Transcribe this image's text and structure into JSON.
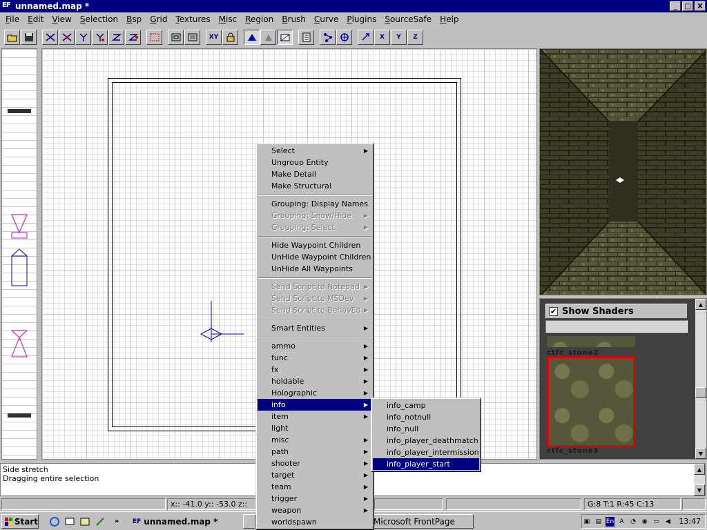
{
  "window": {
    "title": "unnamed.map *",
    "app_icon": "EF",
    "btn_min": "_",
    "btn_max": "□",
    "btn_close": "X"
  },
  "menubar": [
    "File",
    "Edit",
    "View",
    "Selection",
    "Bsp",
    "Grid",
    "Textures",
    "Misc",
    "Region",
    "Brush",
    "Curve",
    "Plugins",
    "SourceSafe",
    "Help"
  ],
  "toolbar": {
    "icons": [
      "open-icon",
      "save-icon",
      "flip-x-icon",
      "rotate-x-icon",
      "flip-y-icon",
      "rotate-y-icon",
      "flip-z-icon",
      "rotate-z-icon",
      "select-complete-tall-icon",
      "select-touching-icon",
      "select-partial-tall-icon",
      "select-inside-icon",
      "change-view-icon",
      "texture-lock-icon",
      "clipper-icon",
      "show-entities-icon",
      "cubic-clip-icon",
      "brush-list-icon",
      "entity-tree-icon",
      "camera-move-icon",
      "scale-icon",
      "scale-x-icon",
      "scale-y-icon",
      "scale-z-icon"
    ],
    "labels": {
      "change_view": "XY",
      "scale_x": "X",
      "scale_y": "Y",
      "scale_z": "Z"
    }
  },
  "context_menu": {
    "items": [
      {
        "label": "Select",
        "submenu": true,
        "disabled": false
      },
      {
        "label": "Ungroup Entity",
        "submenu": false,
        "disabled": false
      },
      {
        "label": "Make Detail",
        "submenu": false,
        "disabled": false
      },
      {
        "label": "Make Structural",
        "submenu": false,
        "disabled": false
      },
      {
        "sep": true
      },
      {
        "label": "Grouping: Display Names",
        "submenu": false,
        "disabled": false
      },
      {
        "label": "Grouping: Show/Hide",
        "submenu": true,
        "disabled": true
      },
      {
        "label": "Grouping: Select",
        "submenu": true,
        "disabled": true
      },
      {
        "sep": true
      },
      {
        "label": "Hide Waypoint Children",
        "submenu": false,
        "disabled": false
      },
      {
        "label": "UnHide Waypoint Children",
        "submenu": false,
        "disabled": false
      },
      {
        "label": "UnHide All Waypoints",
        "submenu": false,
        "disabled": false
      },
      {
        "sep": true
      },
      {
        "label": "Send Script to Notepad",
        "submenu": true,
        "disabled": true
      },
      {
        "label": "Send Script to MSDev",
        "submenu": true,
        "disabled": true
      },
      {
        "label": "Send Script to BehavEd",
        "submenu": true,
        "disabled": true
      },
      {
        "sep": true
      },
      {
        "label": "Smart Entities",
        "submenu": true,
        "disabled": false
      },
      {
        "sep": true
      },
      {
        "label": "ammo",
        "submenu": true,
        "disabled": false
      },
      {
        "label": "func",
        "submenu": true,
        "disabled": false
      },
      {
        "label": "fx",
        "submenu": true,
        "disabled": false
      },
      {
        "label": "holdable",
        "submenu": true,
        "disabled": false
      },
      {
        "label": "Holographic",
        "submenu": true,
        "disabled": false
      },
      {
        "label": "info",
        "submenu": true,
        "disabled": false,
        "active": true
      },
      {
        "label": "item",
        "submenu": true,
        "disabled": false
      },
      {
        "label": "light",
        "submenu": false,
        "disabled": false
      },
      {
        "label": "misc",
        "submenu": true,
        "disabled": false
      },
      {
        "label": "path",
        "submenu": true,
        "disabled": false
      },
      {
        "label": "shooter",
        "submenu": true,
        "disabled": false
      },
      {
        "label": "target",
        "submenu": true,
        "disabled": false
      },
      {
        "label": "team",
        "submenu": true,
        "disabled": false
      },
      {
        "label": "trigger",
        "submenu": true,
        "disabled": false
      },
      {
        "label": "weapon",
        "submenu": true,
        "disabled": false
      },
      {
        "label": "worldspawn",
        "submenu": false,
        "disabled": false
      }
    ]
  },
  "submenu_info": {
    "items": [
      {
        "label": "info_camp",
        "active": false
      },
      {
        "label": "info_notnull",
        "active": false
      },
      {
        "label": "info_null",
        "active": false
      },
      {
        "label": "info_player_deathmatch",
        "active": false
      },
      {
        "label": "info_player_intermission",
        "active": false
      },
      {
        "label": "info_player_start",
        "active": true
      }
    ]
  },
  "texture_panel": {
    "show_shaders_label": "Show Shaders",
    "show_shaders_checked": "✔",
    "filter_value": "",
    "textures": [
      "ctfc_stone2",
      "ctfc_stone3"
    ]
  },
  "console": {
    "lines": [
      "Side stretch",
      "Dragging entire selection"
    ]
  },
  "statusbar": {
    "coords": "x:: -41.0  y:: -53.0  z:: ...",
    "grid_info": "G:8 T:1 R:45 C:13"
  },
  "taskbar": {
    "start_label": "Start",
    "more_label": "»",
    "tasks": [
      "unnamed.map *",
      "Microsoft FrontPage"
    ],
    "tray_lang": "En",
    "clock": "13:47"
  },
  "colors": {
    "selection": "#000080",
    "titlebar": "#000080",
    "selected_texture_border": "#e00000",
    "entity_marker": "#cc00cc",
    "player_start": "#0000aa"
  }
}
